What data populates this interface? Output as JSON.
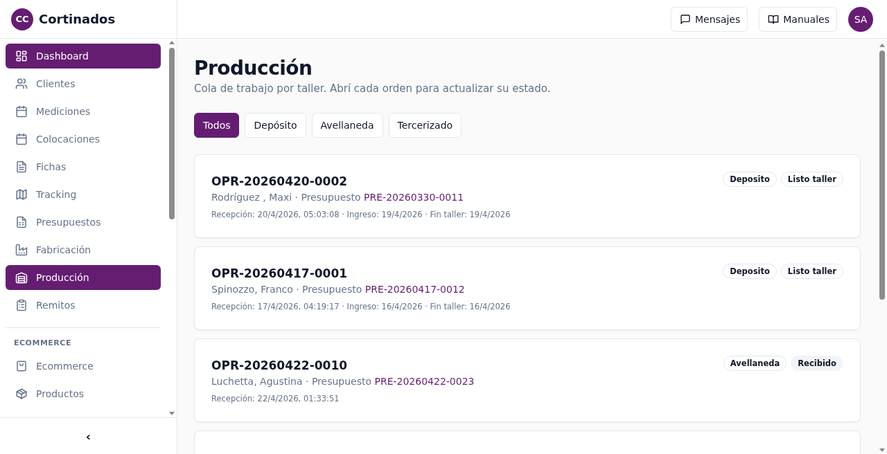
{
  "brand": {
    "initials": "CC",
    "name": "Cortinados"
  },
  "sidebar": {
    "sections": [
      {
        "items": [
          {
            "label": "Dashboard",
            "selected": true
          },
          {
            "label": "Clientes",
            "selected": false
          },
          {
            "label": "Mediciones",
            "selected": false
          },
          {
            "label": "Colocaciones",
            "selected": false
          },
          {
            "label": "Fichas",
            "selected": false
          },
          {
            "label": "Tracking",
            "selected": false
          },
          {
            "label": "Presupuestos",
            "selected": false
          },
          {
            "label": "Fabricación",
            "selected": false
          },
          {
            "label": "Producción",
            "selected": true
          },
          {
            "label": "Remitos",
            "selected": false
          }
        ]
      },
      {
        "heading": "ECOMMERCE",
        "items": [
          {
            "label": "Ecommerce",
            "selected": false
          },
          {
            "label": "Productos",
            "selected": false
          }
        ]
      }
    ],
    "collapse": "‹"
  },
  "header": {
    "buttons": [
      "Mensajes",
      "Manuales"
    ],
    "avatar": "SA"
  },
  "page": {
    "title": "Producción",
    "subtitle": "Cola de trabajo por taller. Abrí cada orden para actualizar su estado.",
    "filters": [
      {
        "label": "Todos",
        "selected": true
      },
      {
        "label": "Depósito",
        "selected": false
      },
      {
        "label": "Avellaneda",
        "selected": false
      },
      {
        "label": "Tercerizado",
        "selected": false
      }
    ],
    "orders": [
      {
        "code": "OPR-20260420-0002",
        "client": "Rodríguez , Maxi · Presupuesto ",
        "quote": "PRE-20260330-0011",
        "dates": "Recepción: 20/4/2026, 05:03:08 · Ingreso: 19/4/2026 · Fin taller: 19/4/2026",
        "badges": [
          {
            "text": "Deposito",
            "kind": "outline"
          },
          {
            "text": "Listo taller",
            "kind": "outline"
          }
        ]
      },
      {
        "code": "OPR-20260417-0001",
        "client": "Spinozzo, Franco · Presupuesto ",
        "quote": "PRE-20260417-0012",
        "dates": "Recepción: 17/4/2026, 04:19:17 · Ingreso: 16/4/2026 · Fin taller: 16/4/2026",
        "badges": [
          {
            "text": "Deposito",
            "kind": "outline"
          },
          {
            "text": "Listo taller",
            "kind": "outline"
          }
        ]
      },
      {
        "code": "OPR-20260422-0010",
        "client": "Luchetta, Agustina · Presupuesto ",
        "quote": "PRE-20260422-0023",
        "dates": "Recepción: 22/4/2026, 01:33:51",
        "badges": [
          {
            "text": "Avellaneda",
            "kind": "outline"
          },
          {
            "text": "Recibido",
            "kind": "filled"
          }
        ]
      }
    ]
  }
}
